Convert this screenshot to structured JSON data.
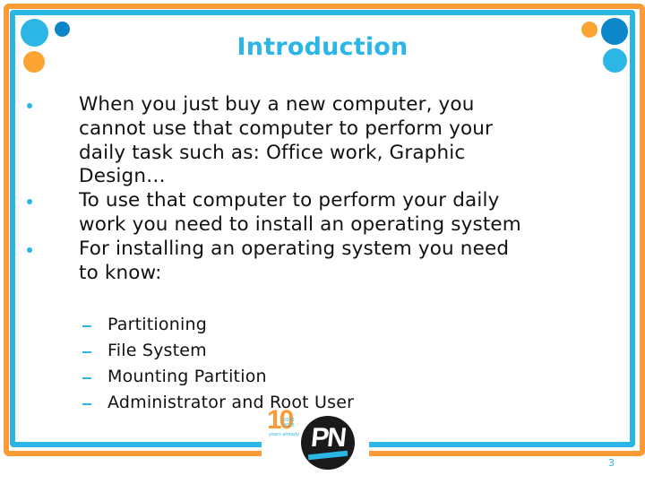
{
  "slide": {
    "title": "Introduction",
    "bullets": [
      {
        "lines": [
          "When you just buy a new computer, you",
          "cannot use that computer to perform your",
          "daily task such as: Office work, Graphic",
          "Design…"
        ]
      },
      {
        "lines": [
          "To use that computer to perform your daily",
          "work you need to install an operating system"
        ]
      },
      {
        "lines": [
          "For installing an operating system you need",
          "to know:"
        ]
      }
    ],
    "sub_bullets": [
      "Partitioning",
      "File System",
      "Mounting Partition",
      "Administrator and Root User"
    ],
    "page_number": "3"
  },
  "logo": {
    "ten_label": "10",
    "ten_years": [
      "2005",
      "2015"
    ],
    "ten_caption": "years already",
    "pn_label": "PN"
  },
  "colors": {
    "orange": "#FB9B35",
    "blue": "#2BB6E6",
    "dark_blue": "#0A86C9",
    "text": "#111111"
  },
  "decor_icons": [
    "circle-large-blue",
    "circle-small-dark-blue",
    "circle-orange"
  ]
}
